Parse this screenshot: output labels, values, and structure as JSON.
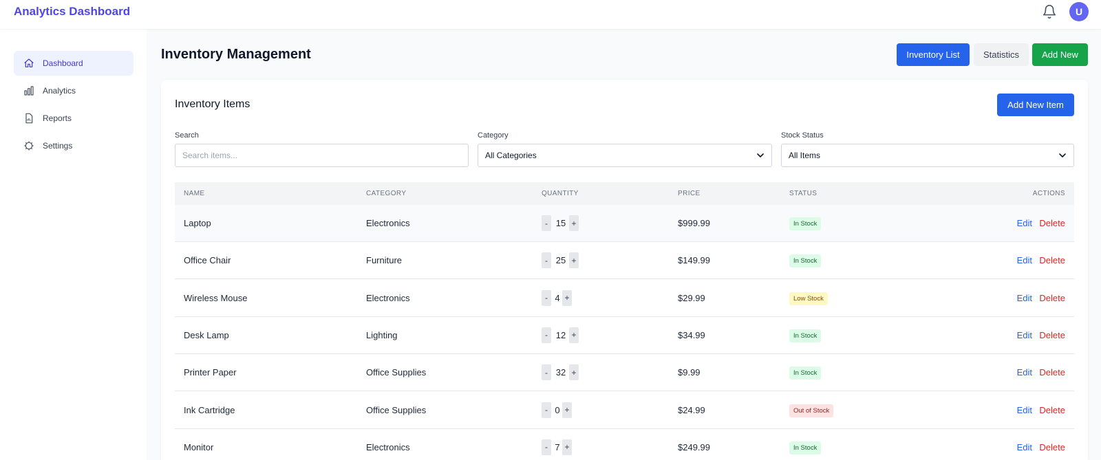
{
  "app": {
    "title": "Analytics Dashboard",
    "user_initial": "U"
  },
  "sidebar": {
    "items": [
      {
        "label": "Dashboard",
        "icon": "home-icon",
        "active": true
      },
      {
        "label": "Analytics",
        "icon": "bar-chart-icon",
        "active": false
      },
      {
        "label": "Reports",
        "icon": "document-icon",
        "active": false
      },
      {
        "label": "Settings",
        "icon": "gear-icon",
        "active": false
      }
    ]
  },
  "header": {
    "title": "Inventory Management",
    "buttons": {
      "inventory_list": "Inventory List",
      "statistics": "Statistics",
      "add_new": "Add New"
    }
  },
  "inventory": {
    "title": "Inventory Items",
    "add_button": "Add New Item",
    "filters": {
      "search_label": "Search",
      "search_placeholder": "Search items...",
      "category_label": "Category",
      "category_value": "All Categories",
      "stock_label": "Stock Status",
      "stock_value": "All Items"
    },
    "columns": [
      "NAME",
      "CATEGORY",
      "QUANTITY",
      "PRICE",
      "STATUS",
      "ACTIONS"
    ],
    "action_labels": {
      "edit": "Edit",
      "delete": "Delete",
      "decrement": "-",
      "increment": "+"
    },
    "rows": [
      {
        "name": "Laptop",
        "category": "Electronics",
        "quantity": "15",
        "price": "$999.99",
        "status": "In Stock",
        "status_color": "green"
      },
      {
        "name": "Office Chair",
        "category": "Furniture",
        "quantity": "25",
        "price": "$149.99",
        "status": "In Stock",
        "status_color": "green"
      },
      {
        "name": "Wireless Mouse",
        "category": "Electronics",
        "quantity": "4",
        "price": "$29.99",
        "status": "Low Stock",
        "status_color": "yellow"
      },
      {
        "name": "Desk Lamp",
        "category": "Lighting",
        "quantity": "12",
        "price": "$34.99",
        "status": "In Stock",
        "status_color": "green"
      },
      {
        "name": "Printer Paper",
        "category": "Office Supplies",
        "quantity": "32",
        "price": "$9.99",
        "status": "In Stock",
        "status_color": "green"
      },
      {
        "name": "Ink Cartridge",
        "category": "Office Supplies",
        "quantity": "0",
        "price": "$24.99",
        "status": "Out of Stock",
        "status_color": "red"
      },
      {
        "name": "Monitor",
        "category": "Electronics",
        "quantity": "7",
        "price": "$249.99",
        "status": "In Stock",
        "status_color": "green"
      }
    ]
  },
  "colors": {
    "brand": "#4f46e5",
    "primary": "#2563eb",
    "success": "#16a34a",
    "danger": "#dc2626"
  }
}
